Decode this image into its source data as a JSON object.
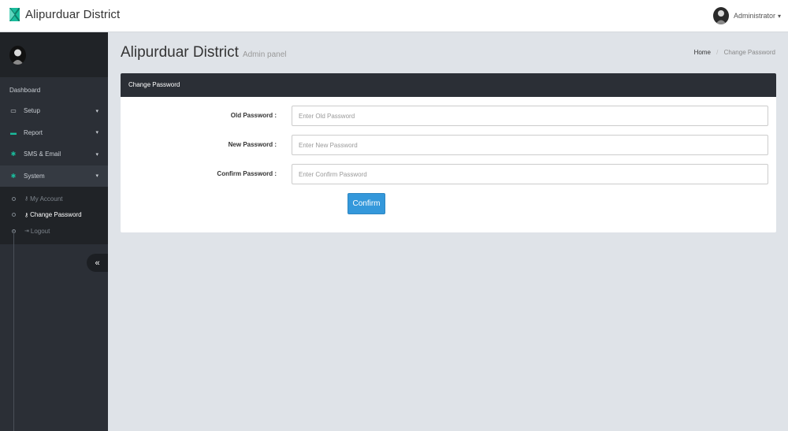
{
  "navbar": {
    "brand_title": "Alipurduar District",
    "user_name": "Administrator",
    "user_caret": "▾"
  },
  "sidebar": {
    "dashboard_label": "Dashboard",
    "items": [
      {
        "label": "Setup",
        "icon": "laptop-icon",
        "glyph": "▭"
      },
      {
        "label": "Report",
        "icon": "monitor-icon",
        "glyph": "▬"
      },
      {
        "label": "SMS & Email",
        "icon": "gear-icon",
        "glyph": "✱"
      },
      {
        "label": "System",
        "icon": "gear-icon",
        "glyph": "✱"
      }
    ],
    "item_caret": "▾",
    "submenu": [
      {
        "label": "My Account",
        "icon": "key-icon",
        "glyph": "⚷"
      },
      {
        "label": "Change Password",
        "icon": "key-icon",
        "glyph": "⚷"
      },
      {
        "label": "Logout",
        "icon": "logout-icon",
        "glyph": "⇥"
      }
    ],
    "collapse_glyph": "«"
  },
  "header": {
    "title": "Alipurduar District",
    "subtitle": "Admin panel",
    "breadcrumb": {
      "home": "Home",
      "separator": "/",
      "current": "Change Password"
    }
  },
  "panel": {
    "title": "Change Password",
    "fields": [
      {
        "label": "Old Password :",
        "placeholder": "Enter Old Password",
        "value": ""
      },
      {
        "label": "New Password :",
        "placeholder": "Enter New Password",
        "value": ""
      },
      {
        "label": "Confirm Password :",
        "placeholder": "Enter Confirm Password",
        "value": ""
      }
    ],
    "confirm_label": "Confirm"
  },
  "colors": {
    "sidebar_bg": "#2b2f36",
    "accent_teal": "#1abc9c",
    "button_blue": "#3498db",
    "content_bg": "#dfe3e8"
  }
}
